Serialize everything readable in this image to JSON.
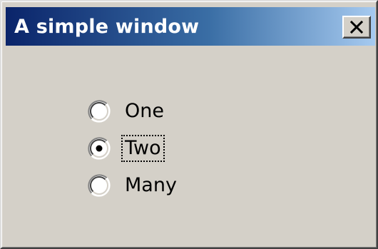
{
  "window": {
    "title": "A simple window",
    "close_symbol": "✕"
  },
  "radio_group": {
    "options": [
      {
        "label": "One",
        "selected": false
      },
      {
        "label": "Two",
        "selected": true,
        "focused": true
      },
      {
        "label": "Many",
        "selected": false
      }
    ]
  },
  "colors": {
    "window_background": "#d4d0c8",
    "titlebar_start": "#0a246a",
    "titlebar_end": "#a6caf0",
    "title_text": "#ffffff"
  },
  "icons": {
    "close": "close-icon",
    "radio": "radio-button-icon"
  }
}
